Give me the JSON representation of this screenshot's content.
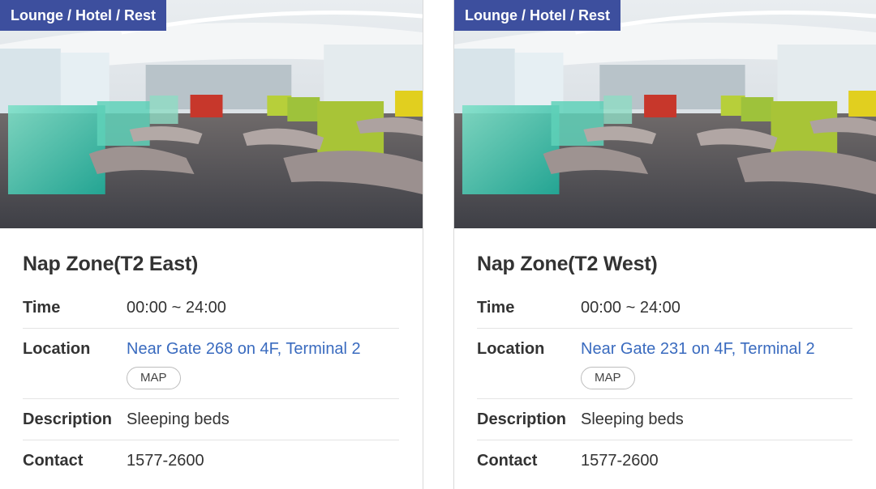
{
  "cards": [
    {
      "category": "Lounge / Hotel / Rest",
      "title": "Nap Zone(T2 East)",
      "time_label": "Time",
      "time_value": "00:00 ~ 24:00",
      "location_label": "Location",
      "location_value": "Near Gate 268 on 4F, Terminal 2",
      "map_label": "MAP",
      "description_label": "Description",
      "description_value": "Sleeping beds",
      "contact_label": "Contact",
      "contact_value": "1577-2600"
    },
    {
      "category": "Lounge / Hotel / Rest",
      "title": "Nap Zone(T2 West)",
      "time_label": "Time",
      "time_value": "00:00 ~ 24:00",
      "location_label": "Location",
      "location_value": "Near Gate 231 on 4F, Terminal 2",
      "map_label": "MAP",
      "description_label": "Description",
      "description_value": "Sleeping beds",
      "contact_label": "Contact",
      "contact_value": "1577-2600"
    }
  ],
  "colors": {
    "tag_background": "#3d4f9e",
    "link": "#3a6bbf"
  }
}
